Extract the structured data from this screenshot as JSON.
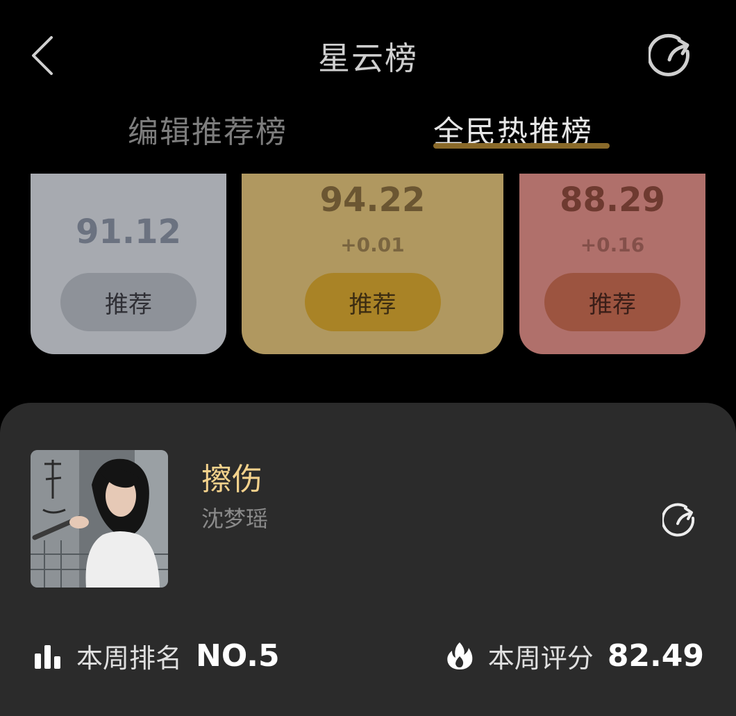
{
  "header": {
    "title": "星云榜"
  },
  "tabs": {
    "editor": "编辑推荐榜",
    "public": "全民热推榜",
    "active": "public"
  },
  "podium": [
    {
      "score": "91.12",
      "delta": "",
      "button": "推荐",
      "color": "#a7aab0"
    },
    {
      "score": "94.22",
      "delta": "+0.01",
      "button": "推荐",
      "color": "#b09860"
    },
    {
      "score": "88.29",
      "delta": "+0.16",
      "button": "推荐",
      "color": "#b0706b"
    }
  ],
  "song": {
    "title": "擦伤",
    "artist": "沈梦瑶"
  },
  "stats": {
    "rank_label": "本周排名",
    "rank_value": "NO.5",
    "score_label": "本周评分",
    "score_value": "82.49"
  },
  "colors": {
    "title_accent": "#f4d28c",
    "tab_underline": "#8a6a2a"
  }
}
